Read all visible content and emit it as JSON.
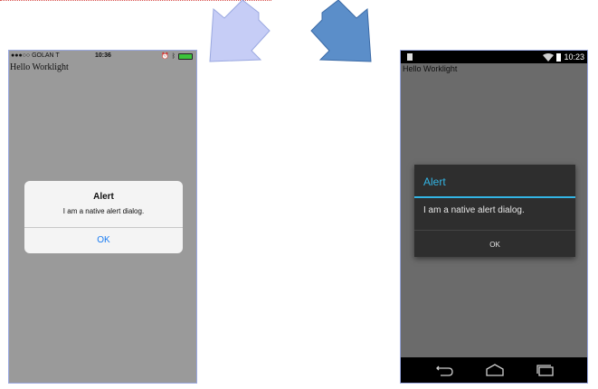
{
  "ios": {
    "carrier": "●●●○○ GOLAN T",
    "time": "10:36",
    "app_title": "Hello Worklight",
    "alert": {
      "title": "Alert",
      "message": "I am a native alert dialog.",
      "ok_label": "OK"
    }
  },
  "android": {
    "time": "10:23",
    "app_title": "Hello Worklight",
    "dialog": {
      "title": "Alert",
      "message": "I am a native alert dialog.",
      "ok_label": "OK"
    },
    "accent_color": "#33b5e5"
  },
  "icons": [
    "arrow-down-left-icon",
    "arrow-down-right-icon",
    "wifi-icon",
    "battery-icon",
    "back-icon",
    "home-icon",
    "recents-icon"
  ]
}
